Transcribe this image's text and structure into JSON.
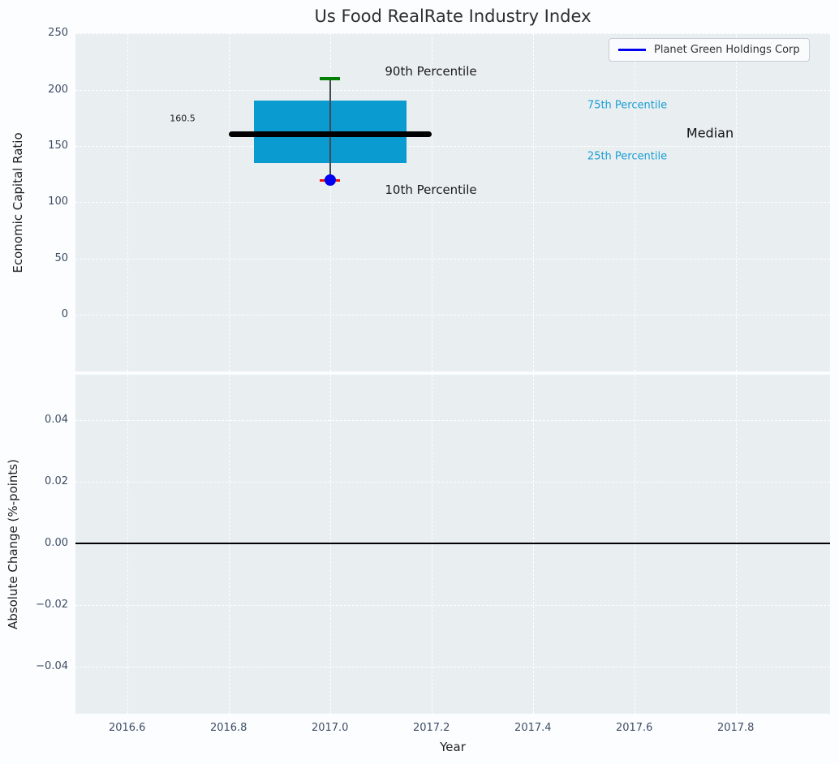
{
  "title": "Us Food RealRate Industry Index",
  "legend": {
    "label": "Planet Green Holdings Corp"
  },
  "colors": {
    "box_fill": "#0a9bd1",
    "percentile_text": "#1b9fd3",
    "company_blue": "#0000ee",
    "p90_cap_green": "#008000",
    "p10_cap_red": "#ee1111",
    "median_line": "#000000",
    "axes_background": "#e9eef1",
    "tick_label": "#3e4d65"
  },
  "chart_data": [
    {
      "type": "boxplot",
      "title": "Us Food RealRate Industry Index",
      "xlabel": "Year",
      "ylabel": "Economic Capital Ratio",
      "xlim": [
        2016.498,
        2017.986
      ],
      "ylim": [
        -50.2,
        250
      ],
      "grid": true,
      "x_ticks": [
        2016.6,
        2016.8,
        2017.0,
        2017.2,
        2017.4,
        2017.6,
        2017.8
      ],
      "x_tick_labels": [
        "2016.6",
        "2016.8",
        "2017.0",
        "2017.2",
        "2017.4",
        "2017.6",
        "2017.8"
      ],
      "y_ticks": [
        250,
        200,
        150,
        100,
        50,
        0
      ],
      "y_tick_labels": [
        "250",
        "200",
        "150",
        "100",
        "50",
        "0"
      ],
      "legend_entries": [
        "Planet Green Holdings Corp"
      ],
      "legend_position": "upper right",
      "box": {
        "x": 2017.0,
        "p90": 210,
        "p75": 190,
        "median": 160.5,
        "p25": 135,
        "p10": 119.5,
        "box_half_width": 0.15,
        "median_half_width": 0.2,
        "cap_half_width": 0.02
      },
      "company_point": {
        "x": 2017.0,
        "y": 119.5,
        "name": "Planet Green Holdings Corp"
      },
      "annotations": {
        "median_value": "160.5",
        "p90": "90th Percentile",
        "p75": "75th Percentile",
        "median": "Median",
        "p25": "25th Percentile",
        "p10": "10th Percentile"
      }
    },
    {
      "type": "line",
      "xlabel": "Year",
      "ylabel": "Absolute Change (%-points)",
      "xlim": [
        2016.498,
        2017.986
      ],
      "ylim": [
        -0.0553,
        0.0547
      ],
      "grid": true,
      "x_ticks": [
        2016.6,
        2016.8,
        2017.0,
        2017.2,
        2017.4,
        2017.6,
        2017.8
      ],
      "x_tick_labels": [
        "2016.6",
        "2016.8",
        "2017.0",
        "2017.2",
        "2017.4",
        "2017.6",
        "2017.8"
      ],
      "y_ticks": [
        0.04,
        0.02,
        0.0,
        -0.02,
        -0.04
      ],
      "y_tick_labels": [
        "0.04",
        "0.02",
        "0.00",
        "−0.02",
        "−0.04"
      ],
      "zero_line": 0.0
    }
  ]
}
